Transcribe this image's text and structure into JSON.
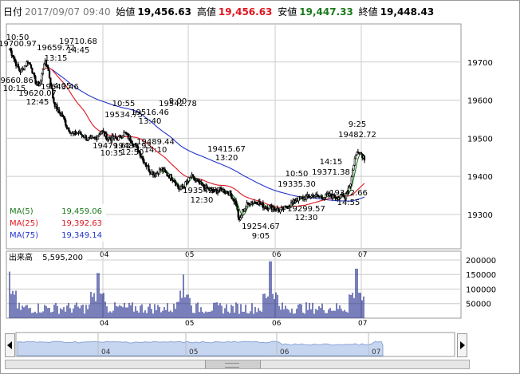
{
  "header": {
    "date_label": "日付",
    "date": "2017/09/07 09:40",
    "open_label": "始値",
    "open": "19,456.63",
    "high_label": "高値",
    "high": "19,456.63",
    "low_label": "安値",
    "low": "19,447.33",
    "close_label": "終値",
    "close": "19,448.43"
  },
  "colors": {
    "ma5": "#1a7a1a",
    "ma25": "#e0141e",
    "ma75": "#2233cc",
    "volume": "#1f2a8c",
    "candle": "#000000",
    "overview_fill": "#c7d6f0",
    "overview_line": "#8aa4d6",
    "grid": "#cccccc"
  },
  "legend": {
    "ma5": {
      "label": "MA(5)",
      "value": "19,459.06"
    },
    "ma25": {
      "label": "MA(25)",
      "value": "19,392.63"
    },
    "ma75": {
      "label": "MA(75)",
      "value": "19,349.14"
    }
  },
  "volume_panel": {
    "label": "出来高",
    "value": "5,595,200",
    "ticks": [
      "200000",
      "150000",
      "100000",
      "50000"
    ]
  },
  "overview": {
    "x_labels": [
      "04",
      "05",
      "06",
      "07"
    ]
  },
  "chart_data": [
    {
      "type": "candlestick",
      "title": "",
      "x_tick_labels": [
        "04",
        "05",
        "06",
        "07"
      ],
      "y_tick_labels": [
        "19700",
        "19600",
        "19500",
        "19400",
        "19300"
      ],
      "ylim": [
        19210,
        19800
      ],
      "grid": true,
      "legend_position": "bottom-left",
      "close_path": [
        [
          0,
          19735
        ],
        [
          0.03,
          19715
        ],
        [
          0.05,
          19700
        ],
        [
          0.08,
          19680
        ],
        [
          0.1,
          19675
        ],
        [
          0.13,
          19690
        ],
        [
          0.16,
          19702
        ],
        [
          0.19,
          19688
        ],
        [
          0.21,
          19660
        ],
        [
          0.24,
          19640
        ],
        [
          0.27,
          19645
        ],
        [
          0.3,
          19700
        ],
        [
          0.33,
          19690
        ],
        [
          0.36,
          19640
        ],
        [
          0.38,
          19600
        ],
        [
          0.42,
          19570
        ],
        [
          0.46,
          19560
        ],
        [
          0.5,
          19530
        ],
        [
          0.55,
          19510
        ],
        [
          0.6,
          19515
        ],
        [
          0.65,
          19505
        ],
        [
          0.7,
          19495
        ],
        [
          0.75,
          19500
        ],
        [
          0.8,
          19520
        ],
        [
          0.85,
          19500
        ],
        [
          0.9,
          19500
        ],
        [
          0.95,
          19500
        ],
        [
          1.0,
          19515
        ],
        [
          1.03,
          19505
        ],
        [
          1.07,
          19490
        ],
        [
          1.12,
          19470
        ],
        [
          1.17,
          19440
        ],
        [
          1.22,
          19415
        ],
        [
          1.27,
          19405
        ],
        [
          1.32,
          19420
        ],
        [
          1.37,
          19405
        ],
        [
          1.42,
          19395
        ],
        [
          1.48,
          19365
        ],
        [
          1.53,
          19380
        ],
        [
          1.58,
          19400
        ],
        [
          1.63,
          19385
        ],
        [
          1.7,
          19370
        ],
        [
          1.78,
          19360
        ],
        [
          1.85,
          19365
        ],
        [
          1.92,
          19355
        ],
        [
          1.97,
          19330
        ],
        [
          2.0,
          19280
        ],
        [
          2.03,
          19310
        ],
        [
          2.08,
          19330
        ],
        [
          2.15,
          19335
        ],
        [
          2.22,
          19320
        ],
        [
          2.28,
          19320
        ],
        [
          2.35,
          19310
        ],
        [
          2.42,
          19320
        ],
        [
          2.5,
          19340
        ],
        [
          2.58,
          19345
        ],
        [
          2.65,
          19350
        ],
        [
          2.72,
          19345
        ],
        [
          2.78,
          19350
        ],
        [
          2.85,
          19345
        ],
        [
          2.92,
          19348
        ],
        [
          2.97,
          19385
        ],
        [
          3.0,
          19440
        ],
        [
          3.03,
          19470
        ],
        [
          3.06,
          19460
        ],
        [
          3.09,
          19448
        ]
      ],
      "annotations": [
        {
          "x": 0.2,
          "value": "19700.97",
          "time": "10:50",
          "kind": "high"
        },
        {
          "x": 0.27,
          "value": "19659.72",
          "time": "13:15",
          "kind": "high"
        },
        {
          "x": 0.9,
          "value": "19710.68",
          "time": "14:45",
          "kind": "high"
        },
        {
          "x": 0.08,
          "value": "19660.86",
          "time": "10:15",
          "kind": "low"
        },
        {
          "x": 0.49,
          "value": "19643.46",
          "time": "14:05",
          "kind": "low"
        },
        {
          "x": 0.55,
          "value": "19620.07",
          "time": "12:45",
          "kind": "low"
        },
        {
          "x": 1.32,
          "value": "19534.75",
          "time": "10:55",
          "kind": "high"
        },
        {
          "x": 1.62,
          "value": "19516.46",
          "time": "13:40",
          "kind": "high"
        },
        {
          "x": 2.13,
          "value": "19542.78",
          "time": "9:00",
          "kind": "high"
        },
        {
          "x": 1.28,
          "value": "19479.61",
          "time": "10:35",
          "kind": "low"
        },
        {
          "x": 1.62,
          "value": "19485.93",
          "time": "12:50",
          "kind": "low"
        },
        {
          "x": 1.92,
          "value": "19489.44",
          "time": "14:10",
          "kind": "low"
        },
        {
          "x": 2.7,
          "value": "19415.67",
          "time": "13:20",
          "kind": "high"
        },
        {
          "x": 2.4,
          "value": "19354.59",
          "time": "12:30",
          "kind": "low"
        },
        {
          "x": 3.2,
          "value": "19254.67",
          "time": "9:05",
          "kind": "low"
        },
        {
          "x": 3.28,
          "value": "19335.30",
          "time": "10:50",
          "kind": "high"
        },
        {
          "x": 3.9,
          "value": "19371.38",
          "time": "14:15",
          "kind": "high"
        },
        {
          "x": 3.48,
          "value": "19299.57",
          "time": "12:30",
          "kind": "low"
        },
        {
          "x": 4.22,
          "value": "19342.66",
          "time": "14:55",
          "kind": "low"
        },
        {
          "x": 4.5,
          "value": "19482.72",
          "time": "9:25",
          "kind": "high"
        }
      ]
    },
    {
      "type": "bar",
      "title": "",
      "y_tick_labels": [
        "200000",
        "150000",
        "100000",
        "50000"
      ],
      "ylim": [
        0,
        230000
      ]
    }
  ]
}
